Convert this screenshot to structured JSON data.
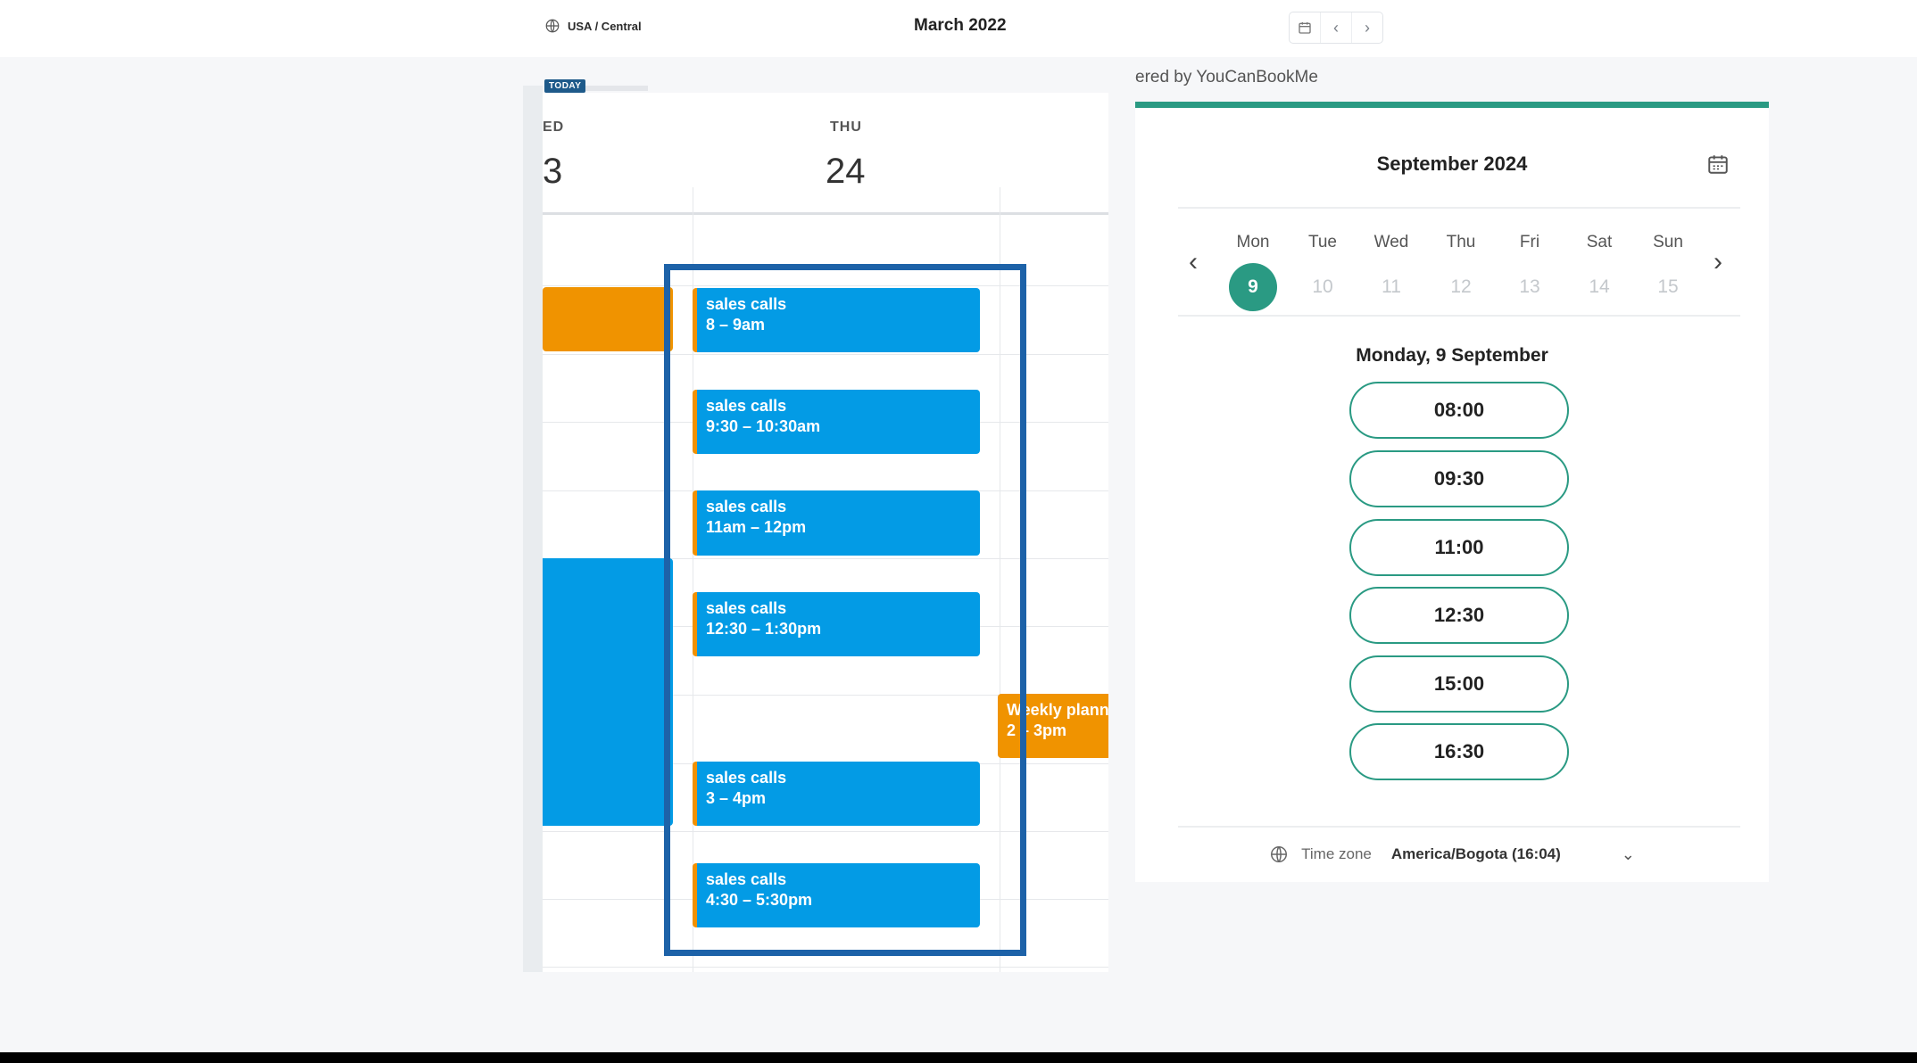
{
  "header": {
    "timezone": "USA / Central",
    "month": "March 2022",
    "nav": {
      "calendar_icon": "calendar-icon",
      "prev_icon": "chevron-left-icon",
      "next_icon": "chevron-right-icon"
    }
  },
  "calendar": {
    "today_badge": "TODAY",
    "days": [
      {
        "abbr": "ED",
        "num": "3"
      },
      {
        "abbr": "THU",
        "num": "24"
      }
    ],
    "events_left": [
      {
        "title": "",
        "time": ""
      },
      {
        "title": "",
        "time": ""
      }
    ],
    "events": [
      {
        "title": "sales calls",
        "time": "8 – 9am"
      },
      {
        "title": "sales calls",
        "time": "9:30 – 10:30am"
      },
      {
        "title": "sales calls",
        "time": "11am – 12pm"
      },
      {
        "title": "sales calls",
        "time": "12:30 – 1:30pm"
      },
      {
        "title": "sales calls",
        "time": "3 – 4pm"
      },
      {
        "title": "sales calls",
        "time": "4:30 – 5:30pm"
      }
    ],
    "event_right": {
      "title": "Weekly plann",
      "time": "2 – 3pm"
    }
  },
  "widget": {
    "powered_by": "ered by YouCanBookMe",
    "month": "September 2024",
    "week": [
      {
        "name": "Mon",
        "num": "9",
        "selected": true
      },
      {
        "name": "Tue",
        "num": "10"
      },
      {
        "name": "Wed",
        "num": "11"
      },
      {
        "name": "Thu",
        "num": "12"
      },
      {
        "name": "Fri",
        "num": "13"
      },
      {
        "name": "Sat",
        "num": "14"
      },
      {
        "name": "Sun",
        "num": "15"
      }
    ],
    "selected_date": "Monday, 9 September",
    "slots": [
      "08:00",
      "09:30",
      "11:00",
      "12:30",
      "15:00",
      "16:30"
    ],
    "timezone_label": "Time zone",
    "timezone_value": "America/Bogota (16:04)"
  },
  "colors": {
    "event_blue": "#039be5",
    "event_orange": "#f09300",
    "highlight": "#1d62a8",
    "accent_teal": "#2a9a83"
  }
}
